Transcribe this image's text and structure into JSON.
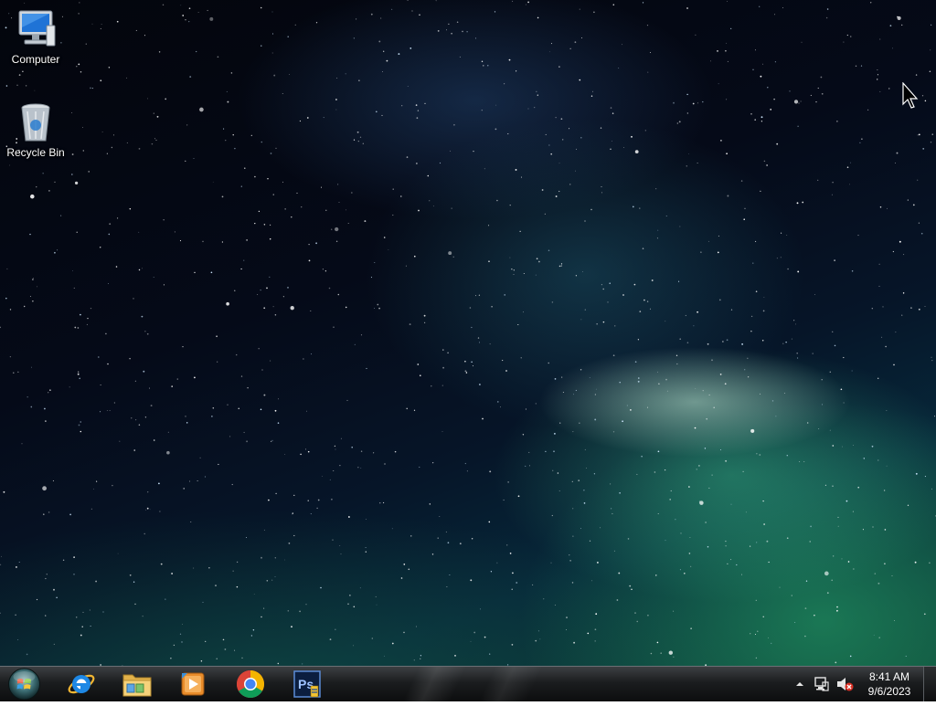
{
  "desktop": {
    "icons": [
      {
        "label": "Computer",
        "icon": "computer-icon"
      },
      {
        "label": "Recycle Bin",
        "icon": "recycle-bin-icon"
      }
    ]
  },
  "taskbar": {
    "start": {
      "icon": "windows-orb-icon"
    },
    "pinned": [
      {
        "app": "internet-explorer",
        "icon": "internet-explorer-icon"
      },
      {
        "app": "windows-explorer",
        "icon": "folder-icon"
      },
      {
        "app": "media-player",
        "icon": "media-player-icon"
      },
      {
        "app": "chrome",
        "icon": "chrome-icon"
      },
      {
        "app": "photoshop",
        "icon": "photoshop-icon",
        "text": "Ps"
      }
    ],
    "tray": {
      "icons": [
        "show-hidden-icons-arrow-icon",
        "network-icon",
        "volume-muted-icon"
      ],
      "time": "8:41 AM",
      "date": "9/6/2023"
    }
  },
  "colors": {
    "taskbar": "#1b1d1f",
    "accent_green": "#2faf6e",
    "sky": "#050a18"
  }
}
